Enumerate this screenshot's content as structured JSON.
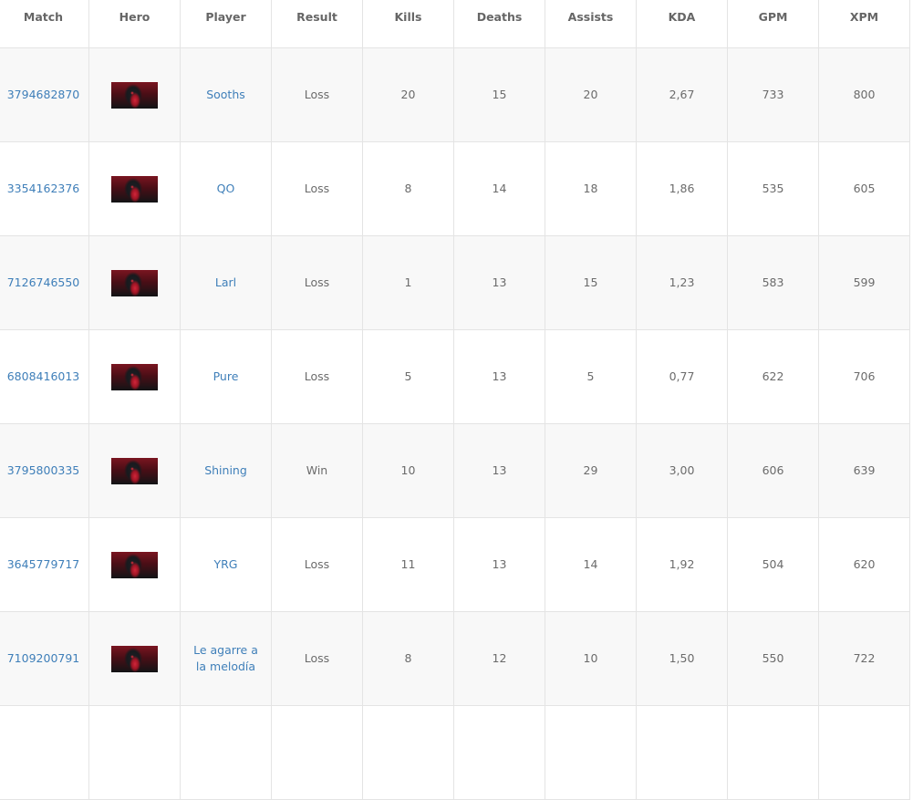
{
  "columns": [
    "Match",
    "Hero",
    "Player",
    "Result",
    "Kills",
    "Deaths",
    "Assists",
    "KDA",
    "GPM",
    "XPM"
  ],
  "hero_icon": "hero-portrait-icon",
  "rows": [
    {
      "match": "3794682870",
      "player": "Sooths",
      "result": "Loss",
      "kills": "20",
      "deaths": "15",
      "assists": "20",
      "kda": "2,67",
      "gpm": "733",
      "xpm": "800"
    },
    {
      "match": "3354162376",
      "player": "QO",
      "result": "Loss",
      "kills": "8",
      "deaths": "14",
      "assists": "18",
      "kda": "1,86",
      "gpm": "535",
      "xpm": "605"
    },
    {
      "match": "7126746550",
      "player": "Larl",
      "result": "Loss",
      "kills": "1",
      "deaths": "13",
      "assists": "15",
      "kda": "1,23",
      "gpm": "583",
      "xpm": "599"
    },
    {
      "match": "6808416013",
      "player": "Pure",
      "result": "Loss",
      "kills": "5",
      "deaths": "13",
      "assists": "5",
      "kda": "0,77",
      "gpm": "622",
      "xpm": "706"
    },
    {
      "match": "3795800335",
      "player": "Shining",
      "result": "Win",
      "kills": "10",
      "deaths": "13",
      "assists": "29",
      "kda": "3,00",
      "gpm": "606",
      "xpm": "639"
    },
    {
      "match": "3645779717",
      "player": "YRG",
      "result": "Loss",
      "kills": "11",
      "deaths": "13",
      "assists": "14",
      "kda": "1,92",
      "gpm": "504",
      "xpm": "620"
    },
    {
      "match": "7109200791",
      "player": "Le agarre a la melodía",
      "result": "Loss",
      "kills": "8",
      "deaths": "12",
      "assists": "10",
      "kda": "1,50",
      "gpm": "550",
      "xpm": "722"
    }
  ],
  "colors": {
    "link": "#3f7fb9",
    "text": "#6b6b6b",
    "border": "#e4e4e4",
    "stripe": "#f8f8f8"
  }
}
